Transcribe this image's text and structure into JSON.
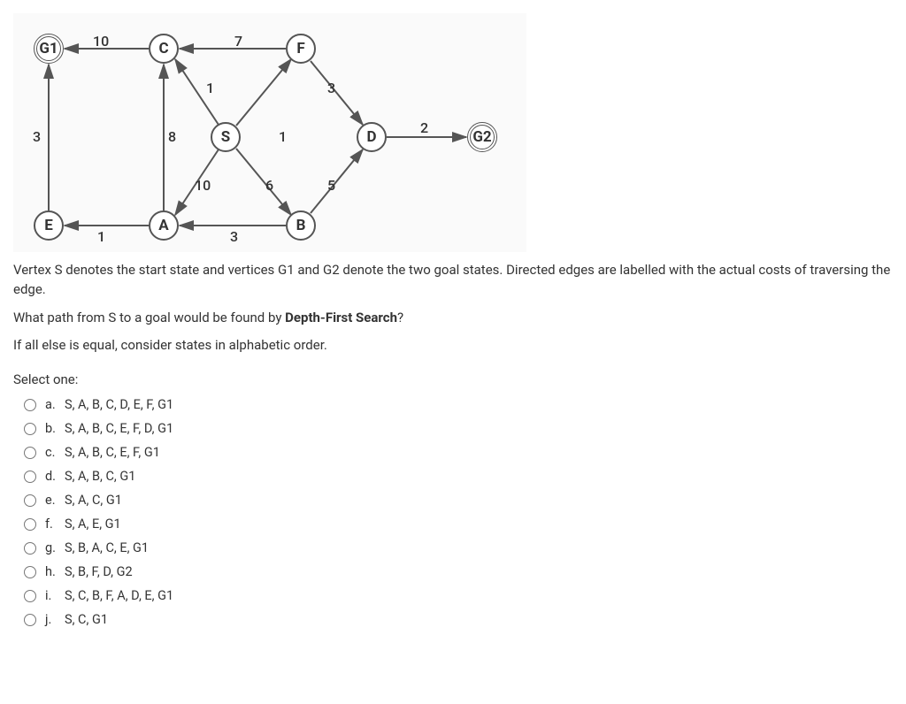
{
  "graph": {
    "nodes": {
      "G1": "G1",
      "C": "C",
      "F": "F",
      "E": "E",
      "A": "A",
      "B": "B",
      "S": "S",
      "D": "D",
      "G2": "G2"
    },
    "edge_labels": {
      "CG1": "10",
      "FC": "7",
      "EG1": "3",
      "AE": "1",
      "AC": "8",
      "SC": "1",
      "SA": "10",
      "BA": "3",
      "BF": "6",
      "FD": "3",
      "BD": "5",
      "DG2": "2",
      "SF": "1"
    }
  },
  "question": {
    "p1_a": "Vertex S denotes the start state and vertices G1 and G2 denote the two goal states. Directed edges are labelled with the actual costs of traversing the edge.",
    "p2_a": "What path from S to a goal would be found by ",
    "p2_b": "Depth-First Search",
    "p2_c": "?",
    "p3": "If all else is equal, consider states in alphabetic order."
  },
  "prompt": "Select one:",
  "options": [
    {
      "letter": "a.",
      "text": "S, A, B, C, D, E, F, G1"
    },
    {
      "letter": "b.",
      "text": "S, A, B, C, E, F, D, G1"
    },
    {
      "letter": "c.",
      "text": "S, A, B, C, E, F, G1"
    },
    {
      "letter": "d.",
      "text": "S, A, B, C, G1"
    },
    {
      "letter": "e.",
      "text": "S, A, C, G1"
    },
    {
      "letter": "f.",
      "text": "S, A, E, G1"
    },
    {
      "letter": "g.",
      "text": "S, B, A, C, E, G1"
    },
    {
      "letter": "h.",
      "text": "S, B, F, D, G2"
    },
    {
      "letter": "i.",
      "text": "S, C, B, F, A, D, E, G1"
    },
    {
      "letter": "j.",
      "text": "S, C, G1"
    }
  ]
}
